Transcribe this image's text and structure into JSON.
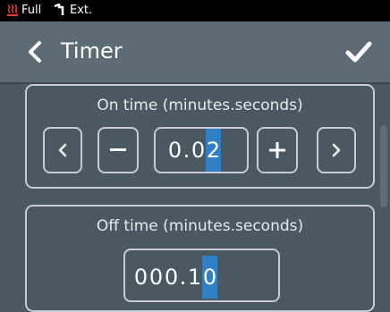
{
  "status": {
    "full_label": "Full",
    "ext_label": "Ext."
  },
  "header": {
    "title": "Timer"
  },
  "on_time": {
    "label": "On time (minutes.seconds)",
    "value": "0.02",
    "digits": [
      "0",
      ".",
      "0",
      "2"
    ],
    "selected_index": 3
  },
  "off_time": {
    "label": "Off time (minutes.seconds)",
    "value": "000.10",
    "digits": [
      "0",
      "0",
      "0",
      ".",
      "1",
      "0"
    ],
    "selected_index": 5
  },
  "colors": {
    "background": "#4a5862",
    "header": "#5d6b75",
    "selection": "#2f80c5",
    "heat_icon": "#e53935"
  },
  "icons": {
    "heat": "heat-icon",
    "external_probe": "probe-icon",
    "back": "chevron-left-icon",
    "confirm": "check-icon"
  }
}
